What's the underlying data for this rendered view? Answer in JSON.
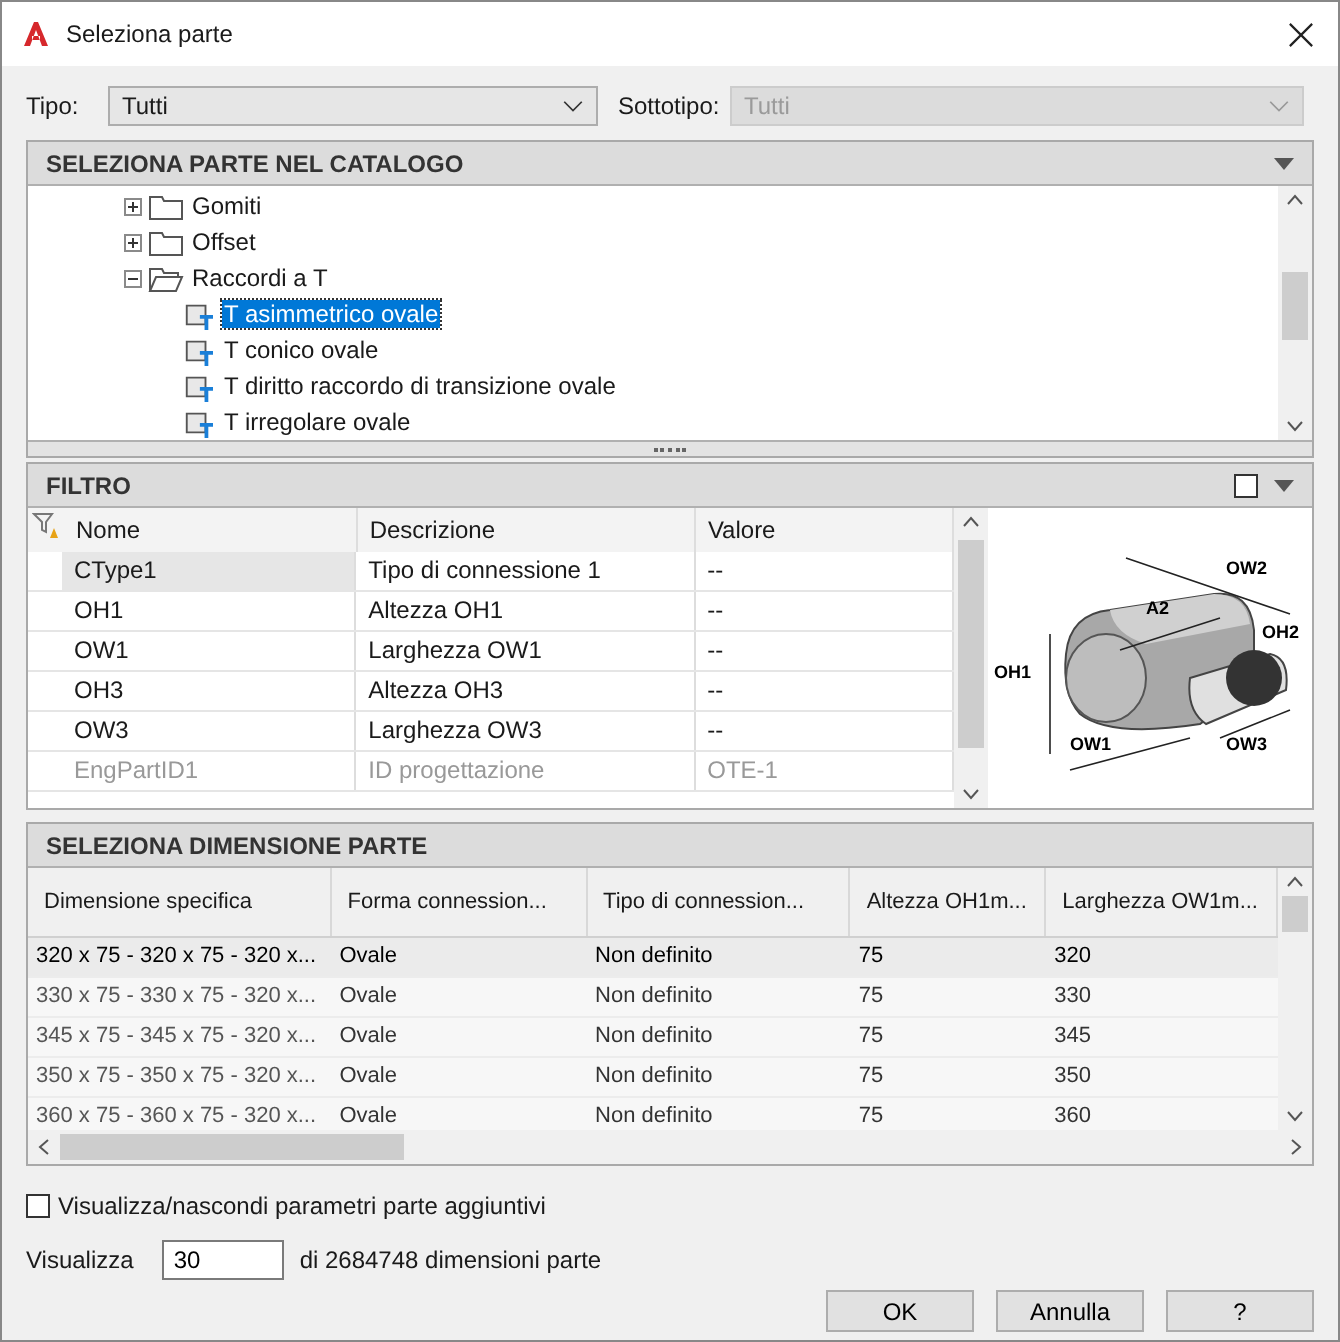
{
  "window": {
    "title": "Seleziona parte"
  },
  "type_row": {
    "tipo_label": "Tipo:",
    "tipo_value": "Tutti",
    "sottotipo_label": "Sottotipo:",
    "sottotipo_value": "Tutti",
    "sottotipo_disabled": true
  },
  "catalog": {
    "title": "SELEZIONA PARTE NEL CATALOGO",
    "tree": [
      {
        "kind": "folder",
        "label": "Gomiti",
        "expanded": false,
        "selected": false
      },
      {
        "kind": "folder",
        "label": "Offset",
        "expanded": false,
        "selected": false
      },
      {
        "kind": "folder",
        "label": "Raccordi a T",
        "expanded": true,
        "selected": false,
        "children": [
          {
            "kind": "part",
            "label": "T asimmetrico ovale",
            "selected": true
          },
          {
            "kind": "part",
            "label": "T conico ovale",
            "selected": false
          },
          {
            "kind": "part",
            "label": "T diritto raccordo di transizione ovale",
            "selected": false
          },
          {
            "kind": "part",
            "label": "T irregolare ovale",
            "selected": false
          }
        ]
      }
    ]
  },
  "filter": {
    "title": "FILTRO",
    "checked": false,
    "columns": [
      "Nome",
      "Descrizione",
      "Valore"
    ],
    "rows": [
      {
        "cells": [
          "CType1",
          "Tipo di connessione 1",
          "--"
        ],
        "selected": true,
        "disabled": false
      },
      {
        "cells": [
          "OH1",
          "Altezza OH1",
          "--"
        ],
        "selected": false,
        "disabled": false
      },
      {
        "cells": [
          "OW1",
          "Larghezza OW1",
          "--"
        ],
        "selected": false,
        "disabled": false
      },
      {
        "cells": [
          "OH3",
          "Altezza OH3",
          "--"
        ],
        "selected": false,
        "disabled": false
      },
      {
        "cells": [
          "OW3",
          "Larghezza OW3",
          "--"
        ],
        "selected": false,
        "disabled": false
      },
      {
        "cells": [
          "EngPartID1",
          "ID progettazione",
          "OTE-1"
        ],
        "selected": false,
        "disabled": true
      }
    ],
    "preview_labels": [
      "OW2",
      "A2",
      "OH2",
      "OH1",
      "OW1",
      "OW3"
    ]
  },
  "sizes": {
    "title": "SELEZIONA DIMENSIONE PARTE",
    "columns": [
      "Dimensione specifica",
      "Forma connession...",
      "Tipo di connession...",
      "Altezza OH1m...",
      "Larghezza OW1m..."
    ],
    "rows": [
      {
        "cells": [
          "320 x 75 - 320 x 75 - 320 x...",
          "Ovale",
          "Non definito",
          "75",
          "320"
        ],
        "selected": true
      },
      {
        "cells": [
          "330 x 75 - 330 x 75 - 320 x...",
          "Ovale",
          "Non definito",
          "75",
          "330"
        ],
        "selected": false
      },
      {
        "cells": [
          "345 x 75 - 345 x 75 - 320 x...",
          "Ovale",
          "Non definito",
          "75",
          "345"
        ],
        "selected": false
      },
      {
        "cells": [
          "350 x 75 - 350 x 75 - 320 x...",
          "Ovale",
          "Non definito",
          "75",
          "350"
        ],
        "selected": false
      },
      {
        "cells": [
          "360 x 75 - 360 x 75 - 320 x...",
          "Ovale",
          "Non definito",
          "75",
          "360"
        ],
        "selected": false
      }
    ]
  },
  "show_params": {
    "label": "Visualizza/nascondi parametri parte aggiuntivi",
    "checked": false
  },
  "display": {
    "label": "Visualizza",
    "value": "30",
    "suffix": "di 2684748 dimensioni parte"
  },
  "buttons": [
    "OK",
    "Annulla",
    "?"
  ]
}
